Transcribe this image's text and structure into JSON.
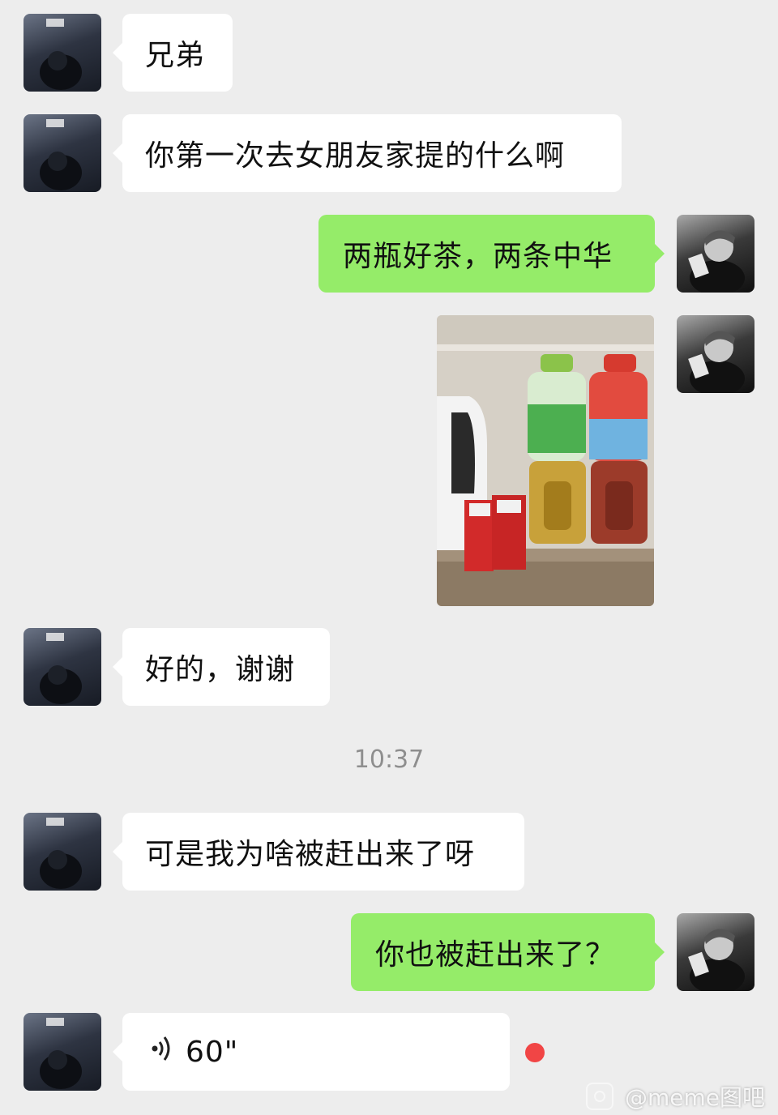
{
  "messages": [
    {
      "side": "left",
      "text": "兄弟"
    },
    {
      "side": "left",
      "text": "你第一次去女朋友家提的什么啊"
    },
    {
      "side": "right",
      "text": "两瓶好茶，两条中华"
    },
    {
      "side": "left",
      "text": "好的，谢谢"
    },
    {
      "side": "left",
      "text": "可是我为啥被赶出来了呀"
    },
    {
      "side": "right",
      "text": "你也被赶出来了？"
    }
  ],
  "timestamp": "10:37",
  "voice_message": {
    "icon": "voice-wave-icon",
    "duration": "60\""
  },
  "unread_indicator_color": "#f14545",
  "bubble_colors": {
    "incoming": "#ffffff",
    "outgoing": "#95ec69"
  },
  "watermark": {
    "text": "@meme图吧"
  }
}
